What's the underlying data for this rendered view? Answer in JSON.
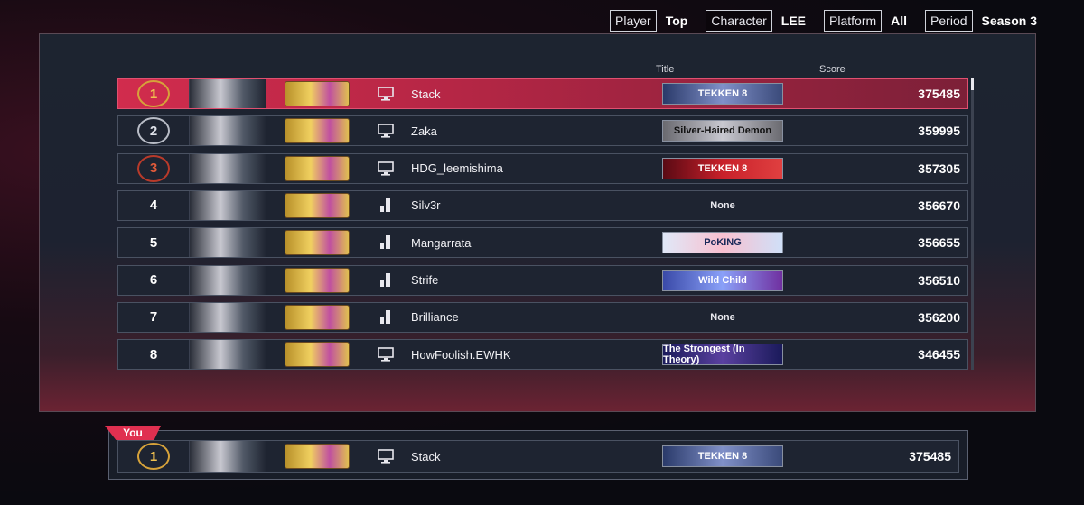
{
  "filters": [
    {
      "label": "Player",
      "value": "Top"
    },
    {
      "label": "Character",
      "value": "LEE"
    },
    {
      "label": "Platform",
      "value": "All"
    },
    {
      "label": "Period",
      "value": "Season 3"
    }
  ],
  "columns": {
    "title": "Title",
    "score": "Score"
  },
  "rows": [
    {
      "rank": "1",
      "medal": "gold",
      "platform": "pc-icon",
      "name": "Stack",
      "title": "TEKKEN 8",
      "title_style": "tekken",
      "score": "375485"
    },
    {
      "rank": "2",
      "medal": "silver",
      "platform": "pc-icon",
      "name": "Zaka",
      "title": "Silver-Haired Demon",
      "title_style": "silver",
      "score": "359995"
    },
    {
      "rank": "3",
      "medal": "bronze",
      "platform": "pc-icon",
      "name": "HDG_leemishima",
      "title": "TEKKEN 8",
      "title_style": "red",
      "score": "357305"
    },
    {
      "rank": "4",
      "medal": "",
      "platform": "console-icon",
      "name": "Silv3r",
      "title": "None",
      "title_style": "none",
      "score": "356670"
    },
    {
      "rank": "5",
      "medal": "",
      "platform": "console-icon",
      "name": "Mangarrata",
      "title": "PoKING",
      "title_style": "sakura",
      "score": "356655"
    },
    {
      "rank": "6",
      "medal": "",
      "platform": "console-icon",
      "name": "Strife",
      "title": "Wild Child",
      "title_style": "wild",
      "score": "356510"
    },
    {
      "rank": "7",
      "medal": "",
      "platform": "console-icon",
      "name": "Brilliance",
      "title": "None",
      "title_style": "none",
      "score": "356200"
    },
    {
      "rank": "8",
      "medal": "",
      "platform": "pc-icon",
      "name": "HowFoolish.EWHK",
      "title": "The Strongest (In Theory)",
      "title_style": "strong",
      "score": "346455"
    }
  ],
  "you": {
    "tag": "You",
    "rank": "1",
    "medal": "gold",
    "platform": "pc-icon",
    "name": "Stack",
    "title": "TEKKEN 8",
    "title_style": "tekken",
    "score": "375485"
  },
  "colors": {
    "accent": "#d12c4d",
    "panel": "#1e2431"
  }
}
